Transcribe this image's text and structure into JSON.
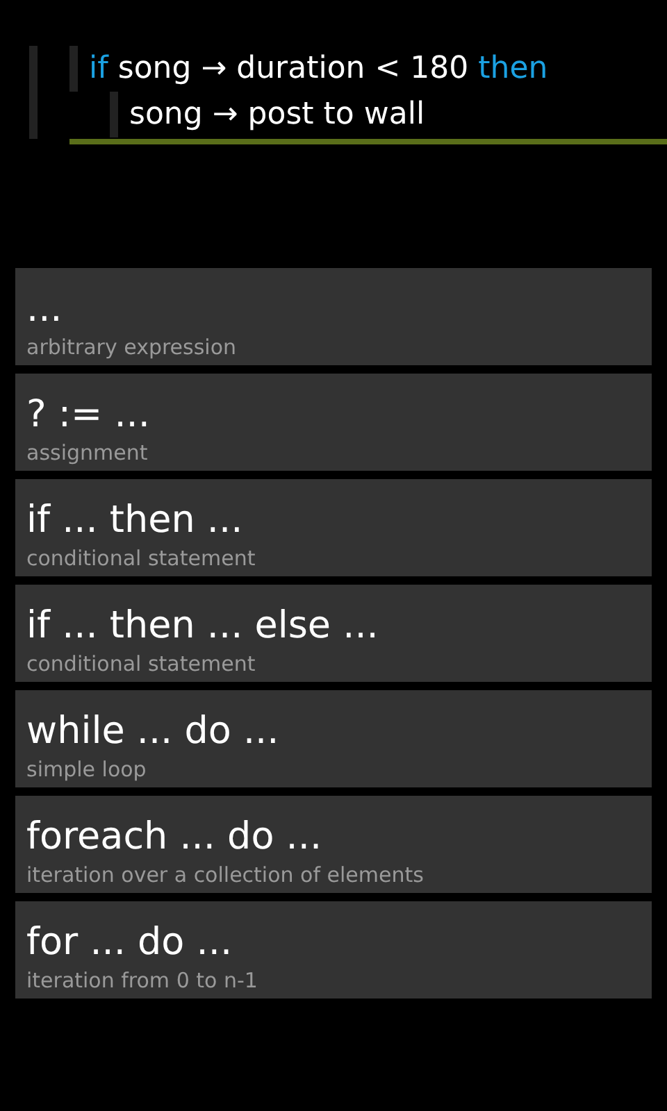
{
  "code": {
    "statement": {
      "selected": true,
      "tokens": [
        {
          "text": "if",
          "kind": "keyword"
        },
        {
          "text": "song",
          "kind": "plain"
        },
        {
          "text": "→",
          "kind": "plain"
        },
        {
          "text": "duration",
          "kind": "plain"
        },
        {
          "text": "<",
          "kind": "plain"
        },
        {
          "text": "180",
          "kind": "plain"
        },
        {
          "text": "then",
          "kind": "keyword"
        }
      ],
      "children": [
        {
          "tokens": [
            {
              "text": "song",
              "kind": "plain"
            },
            {
              "text": "→",
              "kind": "plain"
            },
            {
              "text": "post to wall",
              "kind": "plain"
            }
          ]
        }
      ]
    }
  },
  "templates": [
    {
      "title": "...",
      "subtitle": "arbitrary expression"
    },
    {
      "title": "? := ...",
      "subtitle": "assignment"
    },
    {
      "title": "if ... then ...",
      "subtitle": "conditional statement"
    },
    {
      "title": "if ... then ... else ...",
      "subtitle": "conditional statement"
    },
    {
      "title": "while ... do ...",
      "subtitle": "simple loop"
    },
    {
      "title": "foreach ... do ...",
      "subtitle": "iteration over a collection of elements"
    },
    {
      "title": "for ... do ...",
      "subtitle": "iteration from 0 to n-1"
    }
  ]
}
